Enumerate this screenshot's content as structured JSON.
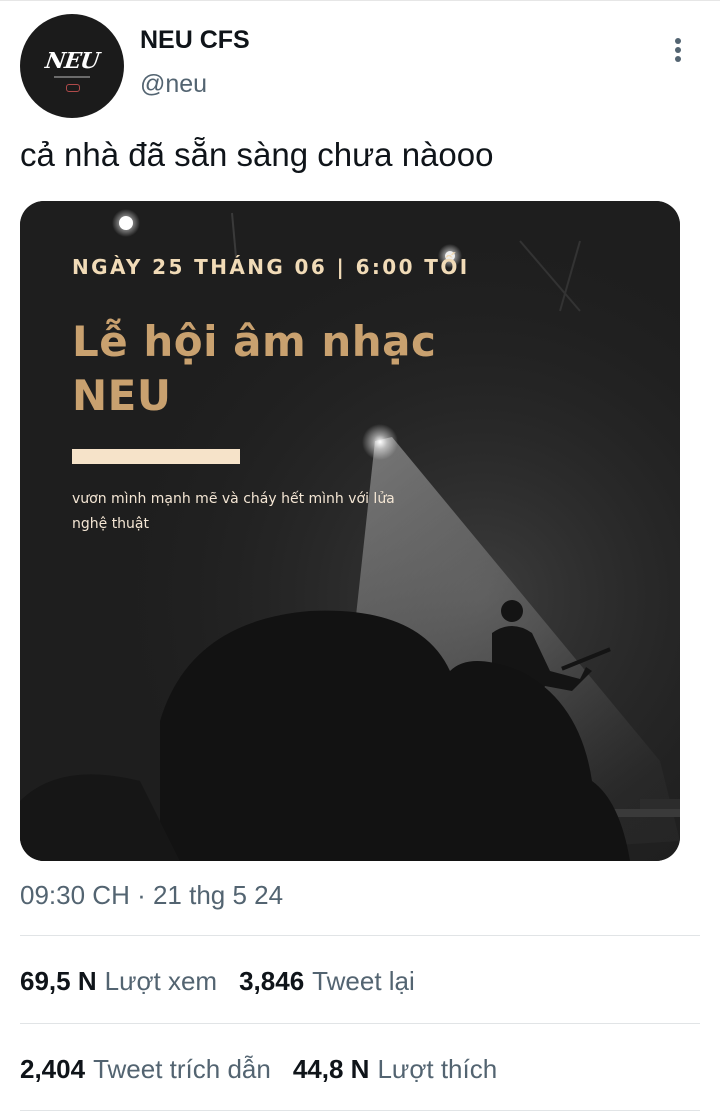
{
  "user": {
    "display_name": "NEU CFS",
    "handle": "@neu",
    "avatar_text": "NEU"
  },
  "tweet": {
    "text": "cả nhà đã sẵn sàng chưa nàooo",
    "timestamp": "09:30 CH · 21 thg 5 24"
  },
  "poster": {
    "date_line": "NGÀY 25 THÁNG 06 | 6:00 TỐI",
    "title_line1": "Lễ hội âm nhạc",
    "title_line2": "NEU",
    "subtitle": "vươn mình mạnh mẽ và cháy hết mình với lửa nghệ thuật"
  },
  "stats": {
    "views_num": "69,5 N",
    "views_label": "Lượt xem",
    "retweets_num": "3,846",
    "retweets_label": "Tweet lại",
    "quotes_num": "2,404",
    "quotes_label": "Tweet trích dẫn",
    "likes_num": "44,8 N",
    "likes_label": "Lượt thích"
  },
  "colors": {
    "text_primary": "#0f1419",
    "text_secondary": "#536471",
    "poster_bg": "#1e1e1e",
    "poster_title": "#c9a16f",
    "poster_date": "#f1dbb7"
  },
  "icons": {
    "more": "vertical-ellipsis-icon"
  }
}
